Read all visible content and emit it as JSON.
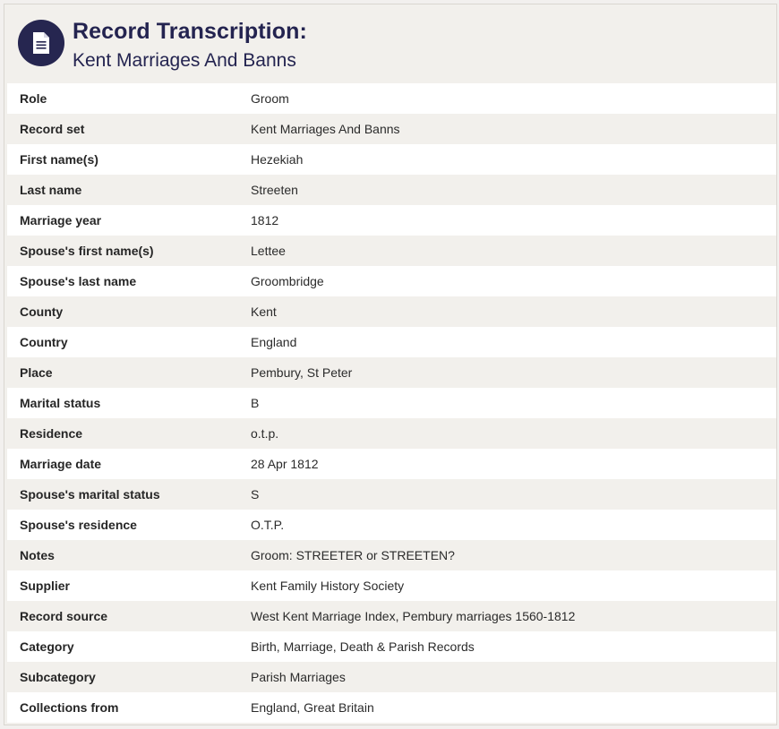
{
  "header": {
    "title": "Record Transcription:",
    "subtitle": "Kent Marriages And Banns",
    "icon": "document-icon",
    "badge_color": "#262650"
  },
  "records": [
    {
      "label": "Role",
      "value": "Groom"
    },
    {
      "label": "Record set",
      "value": "Kent Marriages And Banns"
    },
    {
      "label": "First name(s)",
      "value": "Hezekiah"
    },
    {
      "label": "Last name",
      "value": "Streeten"
    },
    {
      "label": "Marriage year",
      "value": "1812"
    },
    {
      "label": "Spouse's first name(s)",
      "value": "Lettee"
    },
    {
      "label": "Spouse's last name",
      "value": "Groombridge"
    },
    {
      "label": "County",
      "value": "Kent"
    },
    {
      "label": "Country",
      "value": "England"
    },
    {
      "label": "Place",
      "value": "Pembury, St Peter"
    },
    {
      "label": "Marital status",
      "value": "B"
    },
    {
      "label": "Residence",
      "value": "o.t.p."
    },
    {
      "label": "Marriage date",
      "value": "28 Apr 1812"
    },
    {
      "label": "Spouse's marital status",
      "value": "S"
    },
    {
      "label": "Spouse's residence",
      "value": "O.T.P."
    },
    {
      "label": "Notes",
      "value": "Groom: STREETER or STREETEN?"
    },
    {
      "label": "Supplier",
      "value": "Kent Family History Society"
    },
    {
      "label": "Record source",
      "value": "West Kent Marriage Index, Pembury marriages 1560-1812"
    },
    {
      "label": "Category",
      "value": "Birth, Marriage, Death & Parish Records"
    },
    {
      "label": "Subcategory",
      "value": "Parish Marriages"
    },
    {
      "label": "Collections from",
      "value": "England, Great Britain"
    }
  ]
}
